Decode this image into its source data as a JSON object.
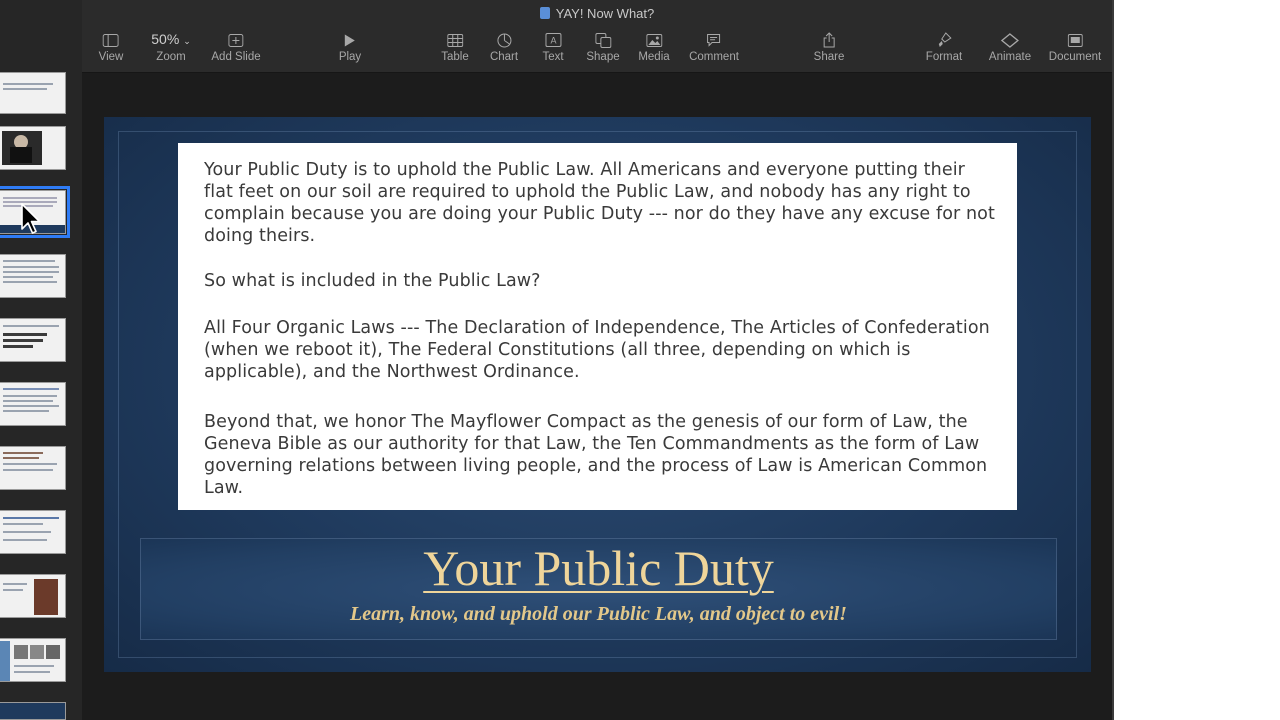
{
  "window": {
    "title": "YAY! Now What?"
  },
  "toolbar": {
    "view_label": "View",
    "zoom_value": "50%",
    "zoom_label": "Zoom",
    "add_slide_label": "Add Slide",
    "play_label": "Play",
    "table_label": "Table",
    "chart_label": "Chart",
    "text_label": "Text",
    "shape_label": "Shape",
    "media_label": "Media",
    "comment_label": "Comment",
    "share_label": "Share",
    "format_label": "Format",
    "animate_label": "Animate",
    "document_label": "Document"
  },
  "slide": {
    "paragraphs": [
      "Your Public Duty is to uphold the Public Law. All Americans and everyone putting their flat feet on our soil are required to uphold the Public Law, and nobody has any right to complain because you are doing your Public Duty --- nor do they have any excuse for not doing theirs.",
      "So what is included in the Public Law?",
      "All Four Organic Laws --- The Declaration of Independence, The Articles of Confederation (when we reboot it), The Federal Constitutions (all three, depending on which is applicable), and the Northwest Ordinance.",
      "Beyond that, we honor The Mayflower Compact as the genesis of our form of Law, the Geneva Bible as our authority for that Law, the Ten Commandments as the form of Law governing relations between living people, and the process of Law is American Common Law."
    ],
    "title": "Your Public Duty",
    "subtitle": "Learn, know, and uphold our Public Law, and object to evil!"
  },
  "colors": {
    "selection": "#2f7cf6",
    "slide_background": "#1f3a5d",
    "title_gold": "#efd59a"
  }
}
